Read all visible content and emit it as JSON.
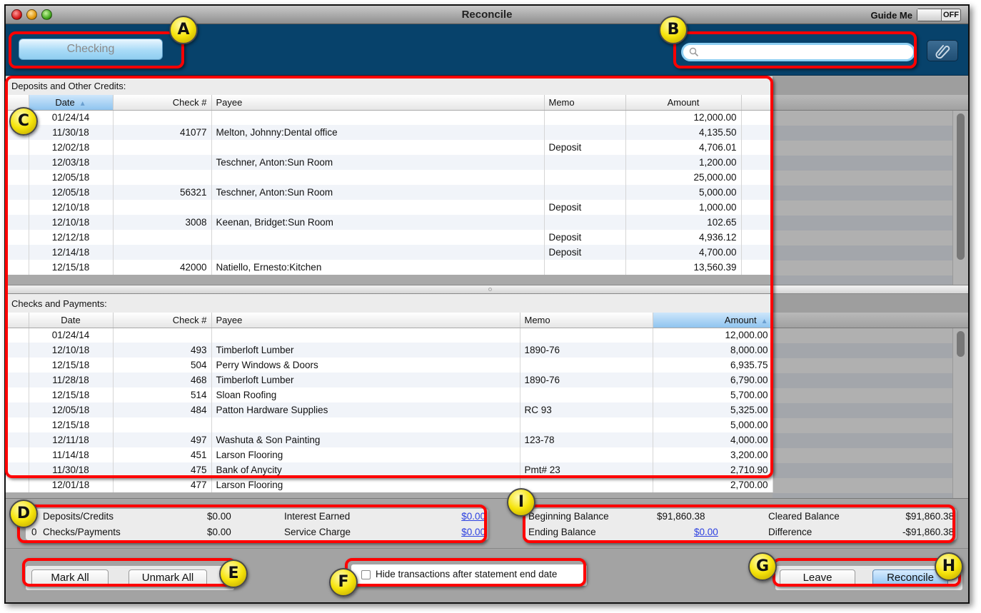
{
  "window": {
    "title": "Reconcile",
    "guide_me": {
      "label": "Guide Me",
      "state": "OFF"
    }
  },
  "toolbar": {
    "account_button": "Checking",
    "search": {
      "value": "",
      "placeholder": ""
    },
    "attach_icon": "paperclip-icon"
  },
  "deposits": {
    "title": "Deposits and Other Credits:",
    "columns": [
      "Date",
      "Check #",
      "Payee",
      "Memo",
      "Amount"
    ],
    "sorted_column": "Date",
    "rows": [
      {
        "date": "01/24/14",
        "check": "",
        "payee": "",
        "memo": "",
        "amount": "12,000.00"
      },
      {
        "date": "11/30/18",
        "check": "41077",
        "payee": "Melton, Johnny:Dental office",
        "memo": "",
        "amount": "4,135.50"
      },
      {
        "date": "12/02/18",
        "check": "",
        "payee": "",
        "memo": "Deposit",
        "amount": "4,706.01"
      },
      {
        "date": "12/03/18",
        "check": "",
        "payee": "Teschner, Anton:Sun Room",
        "memo": "",
        "amount": "1,200.00"
      },
      {
        "date": "12/05/18",
        "check": "",
        "payee": "",
        "memo": "",
        "amount": "25,000.00"
      },
      {
        "date": "12/05/18",
        "check": "56321",
        "payee": "Teschner, Anton:Sun Room",
        "memo": "",
        "amount": "5,000.00"
      },
      {
        "date": "12/10/18",
        "check": "",
        "payee": "",
        "memo": "Deposit",
        "amount": "1,000.00"
      },
      {
        "date": "12/10/18",
        "check": "3008",
        "payee": "Keenan, Bridget:Sun Room",
        "memo": "",
        "amount": "102.65"
      },
      {
        "date": "12/12/18",
        "check": "",
        "payee": "",
        "memo": "Deposit",
        "amount": "4,936.12"
      },
      {
        "date": "12/14/18",
        "check": "",
        "payee": "",
        "memo": "Deposit",
        "amount": "4,700.00"
      },
      {
        "date": "12/15/18",
        "check": "42000",
        "payee": "Natiello, Ernesto:Kitchen",
        "memo": "",
        "amount": "13,560.39"
      }
    ]
  },
  "checks": {
    "title": "Checks and Payments:",
    "columns": [
      "Date",
      "Check #",
      "Payee",
      "Memo",
      "Amount"
    ],
    "sorted_column": "Amount",
    "rows": [
      {
        "date": "01/24/14",
        "check": "",
        "payee": "",
        "memo": "",
        "amount": "12,000.00"
      },
      {
        "date": "12/10/18",
        "check": "493",
        "payee": "Timberloft Lumber",
        "memo": "1890-76",
        "amount": "8,000.00"
      },
      {
        "date": "12/15/18",
        "check": "504",
        "payee": "Perry Windows & Doors",
        "memo": "",
        "amount": "6,935.75"
      },
      {
        "date": "11/28/18",
        "check": "468",
        "payee": "Timberloft Lumber",
        "memo": "1890-76",
        "amount": "6,790.00"
      },
      {
        "date": "12/15/18",
        "check": "514",
        "payee": "Sloan Roofing",
        "memo": "",
        "amount": "5,700.00"
      },
      {
        "date": "12/05/18",
        "check": "484",
        "payee": "Patton Hardware Supplies",
        "memo": "RC 93",
        "amount": "5,325.00"
      },
      {
        "date": "12/15/18",
        "check": "",
        "payee": "",
        "memo": "",
        "amount": "5,000.00"
      },
      {
        "date": "12/11/18",
        "check": "497",
        "payee": "Washuta & Son Painting",
        "memo": "123-78",
        "amount": "4,000.00"
      },
      {
        "date": "11/14/18",
        "check": "451",
        "payee": "Larson Flooring",
        "memo": "",
        "amount": "3,200.00"
      },
      {
        "date": "11/30/18",
        "check": "475",
        "payee": "Bank of Anycity",
        "memo": "Pmt# 23",
        "amount": "2,710.90"
      },
      {
        "date": "12/01/18",
        "check": "477",
        "payee": "Larson Flooring",
        "memo": "",
        "amount": "2,700.00"
      }
    ]
  },
  "summary": {
    "deposits_count": "0",
    "deposits_label": "Deposits/Credits",
    "deposits_value": "$0.00",
    "checks_count": "0",
    "checks_label": "Checks/Payments",
    "checks_value": "$0.00",
    "interest_label": "Interest Earned",
    "interest_value": "$0.00",
    "service_label": "Service Charge",
    "service_value": "$0.00",
    "beginning_label": "Beginning Balance",
    "beginning_value": "$91,860.38",
    "ending_label": "Ending Balance",
    "ending_value": "$0.00",
    "cleared_label": "Cleared Balance",
    "cleared_value": "$91,860.38",
    "difference_label": "Difference",
    "difference_value": "-$91,860.38"
  },
  "bottom": {
    "mark_all": "Mark All",
    "unmark_all": "Unmark All",
    "hide_checkbox_label": "Hide transactions after statement end date",
    "hide_checked": false,
    "leave": "Leave",
    "reconcile": "Reconcile"
  },
  "callouts": [
    "A",
    "B",
    "C",
    "D",
    "E",
    "F",
    "G",
    "H",
    "I"
  ],
  "colors": {
    "toolbar_bg": "#07426b",
    "callout_border": "#ff0000",
    "callout_badge": "#f6e40a",
    "link": "#2b3fe0",
    "sorted_header": "#8fc4ef"
  }
}
